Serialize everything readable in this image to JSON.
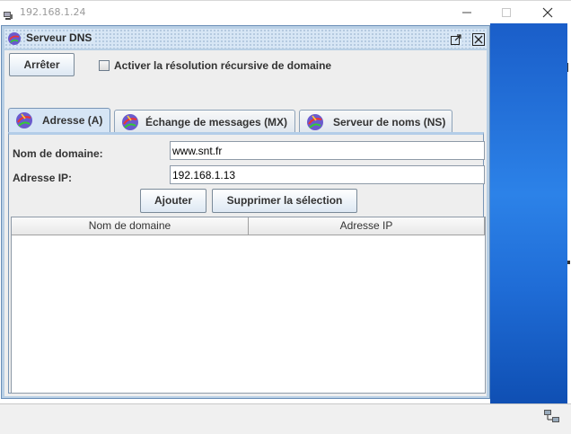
{
  "window": {
    "title": "192.168.1.24",
    "icon": "computer-icon",
    "controls": [
      "minimize-icon",
      "maximize-icon",
      "close-icon"
    ]
  },
  "internal_frame": {
    "title": "Serveur DNS",
    "icon": "network-globe-icon",
    "controls": [
      "maximize-icon",
      "close-icon"
    ]
  },
  "toolbar": {
    "stop_button": "Arrêter",
    "recursive_checkbox_label": "Activer la résolution récursive de domaine",
    "recursive_checked": false
  },
  "tabs": [
    {
      "label": "Adresse (A)",
      "icon": "network-globe-icon",
      "active": true
    },
    {
      "label": "Échange de messages (MX)",
      "icon": "network-globe-icon",
      "active": false
    },
    {
      "label": "Serveur de noms (NS)",
      "icon": "network-globe-icon",
      "active": false
    }
  ],
  "form": {
    "domain_label": "Nom de domaine:",
    "domain_value": "www.snt.fr",
    "ip_label": "Adresse IP:",
    "ip_value": "192.168.1.13",
    "add_button": "Ajouter",
    "delete_button": "Supprimer la sélection"
  },
  "table": {
    "columns": [
      "Nom de domaine",
      "Adresse IP"
    ],
    "rows": []
  },
  "colors": {
    "desktop_blue": "#2c82e8",
    "frame_title_bg": "#d7e6f5",
    "active_tab": "#d6e5f5"
  }
}
